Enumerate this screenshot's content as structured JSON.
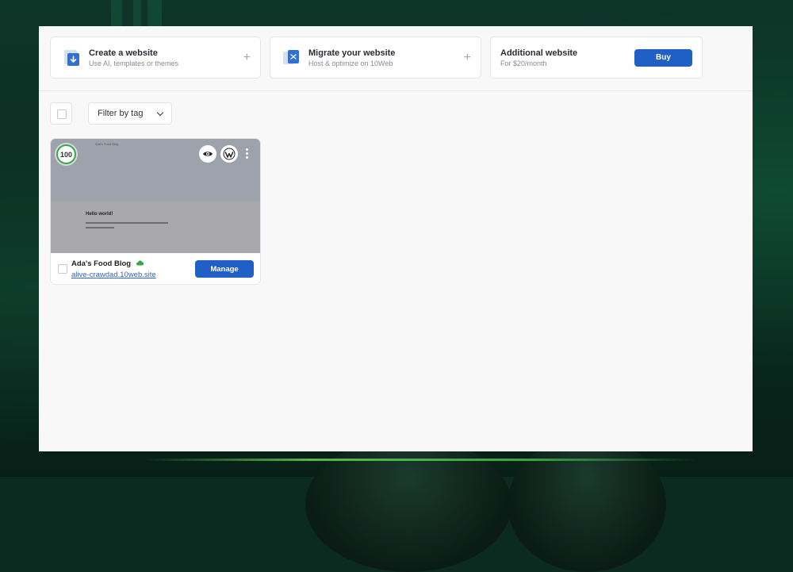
{
  "create_card": {
    "title": "Create a website",
    "subtitle": "Use AI, templates or themes",
    "icon": "website-add-icon",
    "action": "+"
  },
  "migrate_card": {
    "title": "Migrate your website",
    "subtitle": "Host & optimize on 10Web",
    "icon": "migrate-icon",
    "action": "+"
  },
  "additional_card": {
    "title": "Additional website",
    "subtitle": "For $20/month",
    "buy_label": "Buy"
  },
  "toolbar": {
    "filter_label": "Filter by tag"
  },
  "site": {
    "score": "100",
    "name": "Ada's Food Blog",
    "url": "alive-crawdad.10web.site",
    "manage_label": "Manage",
    "preview_heading": "Hello world!",
    "status_icon": "cloud-icon",
    "status_color": "#3aa64b"
  },
  "colors": {
    "accent": "#2060c4",
    "score_ring": "#3aa64b"
  }
}
